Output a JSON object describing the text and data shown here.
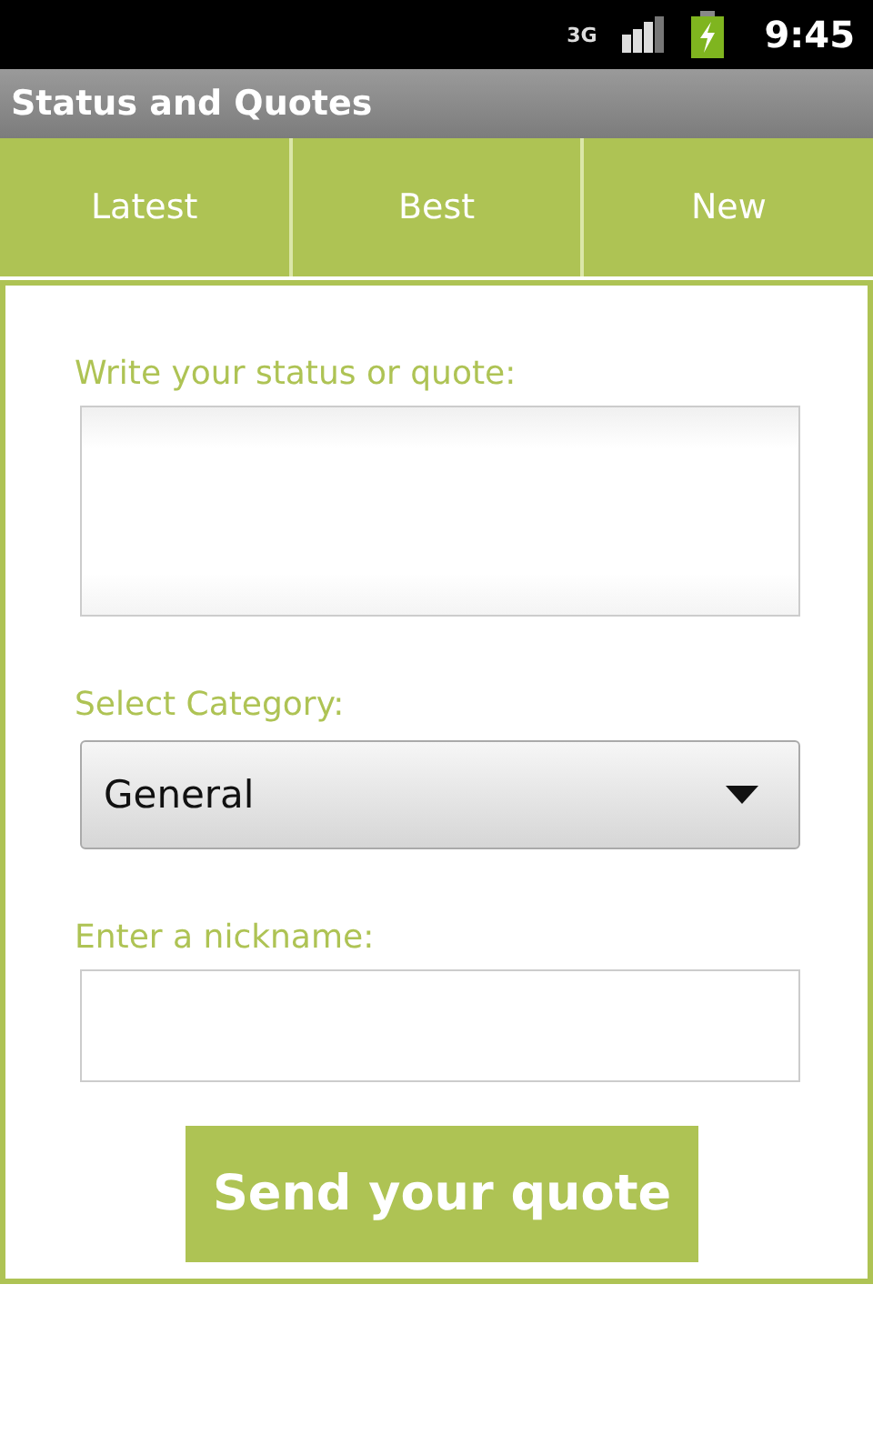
{
  "status_bar": {
    "network": "3G",
    "time": "9:45",
    "battery_charging": true
  },
  "window": {
    "title": "Status and Quotes"
  },
  "tabs": [
    {
      "label": "Latest"
    },
    {
      "label": "Best"
    },
    {
      "label": "New"
    }
  ],
  "form": {
    "status_label": "Write your status or quote:",
    "category_label": "Select Category:",
    "category_value": "General",
    "nickname_label": "Enter a nickname:",
    "submit": "Send your quote"
  }
}
